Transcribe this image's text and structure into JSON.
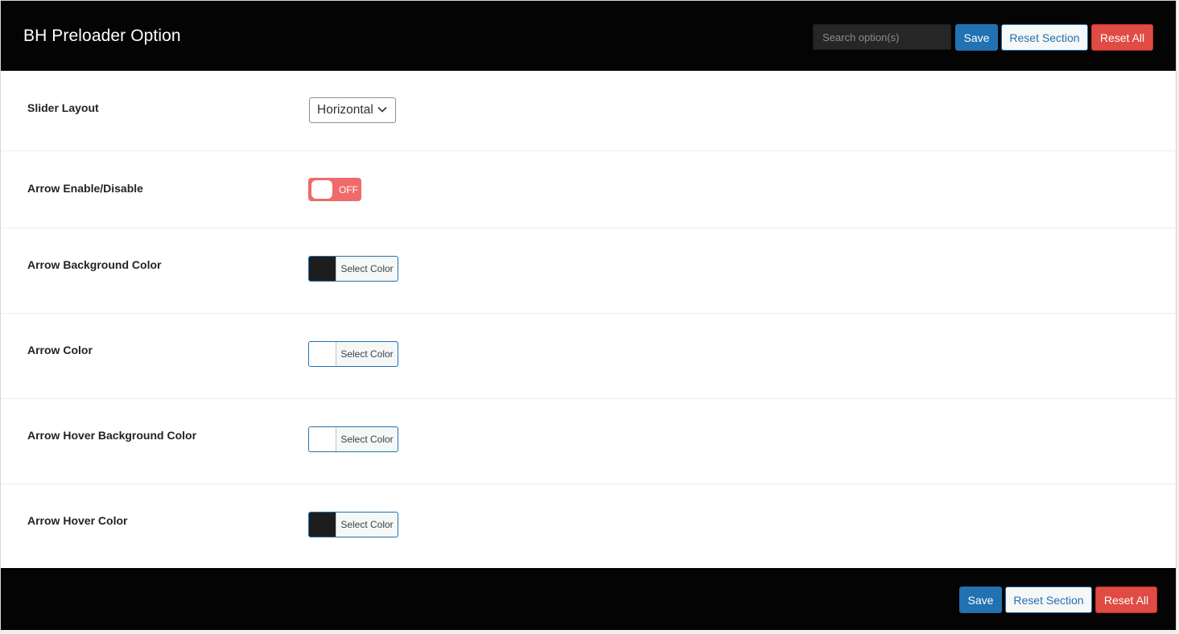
{
  "header": {
    "title": "BH Preloader Option",
    "search_placeholder": "Search option(s)",
    "save_label": "Save",
    "reset_section_label": "Reset Section",
    "reset_all_label": "Reset All"
  },
  "fields": {
    "slider_layout": {
      "label": "Slider Layout",
      "value": "Horizontal"
    },
    "arrow_enable": {
      "label": "Arrow Enable/Disable",
      "state": "OFF"
    },
    "arrow_bg_color": {
      "label": "Arrow Background Color",
      "button": "Select Color",
      "color": "#1d1d1d"
    },
    "arrow_color": {
      "label": "Arrow Color",
      "button": "Select Color",
      "color": "#ffffff"
    },
    "arrow_hover_bg_color": {
      "label": "Arrow Hover Background Color",
      "button": "Select Color",
      "color": "#ffffff"
    },
    "arrow_hover_color": {
      "label": "Arrow Hover Color",
      "button": "Select Color",
      "color": "#1d1d1d"
    }
  },
  "footer": {
    "save_label": "Save",
    "reset_section_label": "Reset Section",
    "reset_all_label": "Reset All"
  },
  "colors": {
    "header_bg": "#040404",
    "primary": "#2271b1",
    "danger": "#e04b45",
    "toggle_off": "#f06a6a"
  }
}
